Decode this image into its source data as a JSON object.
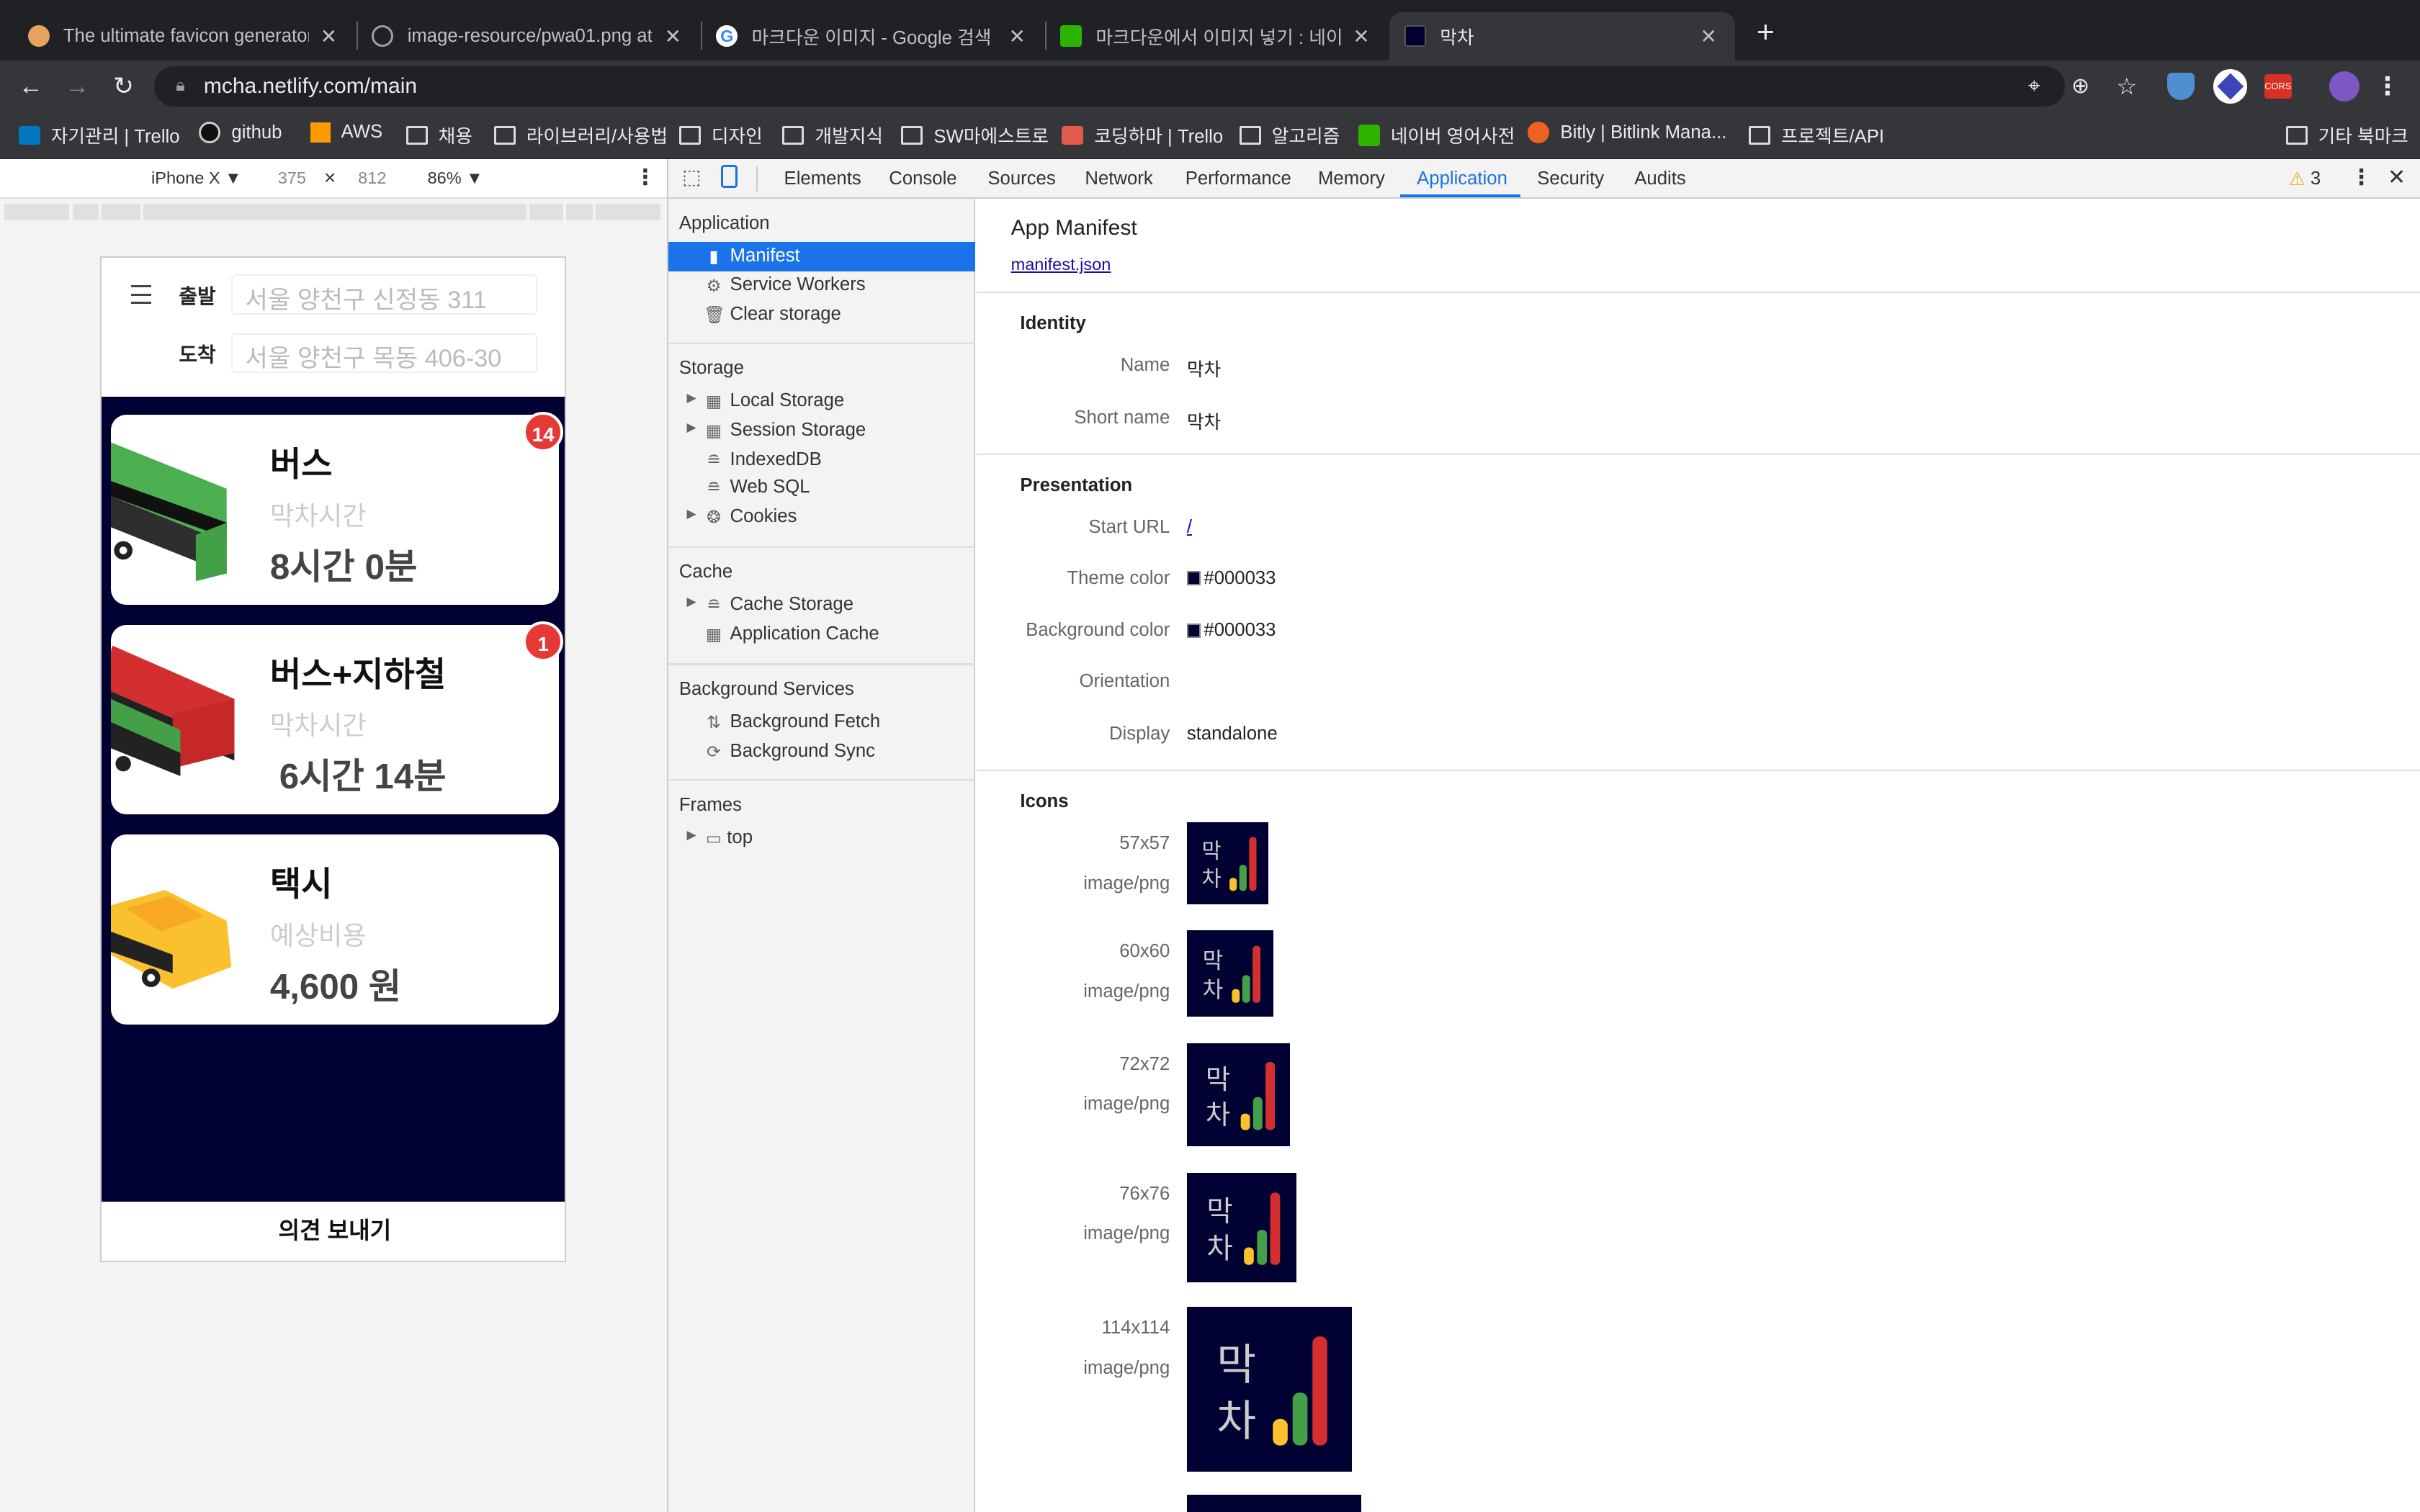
{
  "tabs": [
    {
      "title": "The ultimate favicon generator",
      "fav_color": "#e8a25f"
    },
    {
      "title": "image-resource/pwa01.png at",
      "fav_color": "#202124"
    },
    {
      "title": "마크다운 이미지 - Google 검색",
      "fav_color": "#ffffff"
    },
    {
      "title": "마크다운에서 이미지 넣기 : 네이버",
      "fav_color": "#2db400"
    },
    {
      "title": "막차",
      "fav_color": "#000033"
    }
  ],
  "omnibox": {
    "url": "mcha.netlify.com/main"
  },
  "bookmarks": [
    "자기관리 | Trello",
    "github",
    "AWS",
    "채용",
    "라이브러리/사용법",
    "디자인",
    "개발지식",
    "SW마에스트로",
    "코딩하마 | Trello",
    "알고리즘",
    "네이버 영어사전",
    "Bitly | Bitlink Mana...",
    "프로젝트/API",
    "기타 북마크"
  ],
  "device_toolbar": {
    "device": "iPhone X ▼",
    "width": "375",
    "times": "×",
    "height": "812",
    "zoom": "86% ▼"
  },
  "app": {
    "from_label": "출발",
    "from_value": "서울 양천구 신정동 311",
    "to_label": "도착",
    "to_value": "서울 양천구 목동 406-30",
    "cards": [
      {
        "title": "버스",
        "sub": "막차시간",
        "value": "8시간 0분",
        "badge": "14"
      },
      {
        "title": "버스+지하철",
        "sub": "막차시간",
        "value": "6시간 14분",
        "badge": "1"
      },
      {
        "title": "택시",
        "sub": "예상비용",
        "value": "4,600 원"
      }
    ],
    "footer": "의견 보내기",
    "theme_color": "#000033"
  },
  "devtools": {
    "tabs": [
      "Elements",
      "Console",
      "Sources",
      "Network",
      "Performance",
      "Memory",
      "Application",
      "Security",
      "Audits"
    ],
    "active_tab": "Application",
    "warnings": "3",
    "sidebar": {
      "application": {
        "header": "Application",
        "items": [
          "Manifest",
          "Service Workers",
          "Clear storage"
        ]
      },
      "storage": {
        "header": "Storage",
        "items": [
          "Local Storage",
          "Session Storage",
          "IndexedDB",
          "Web SQL",
          "Cookies"
        ]
      },
      "cache": {
        "header": "Cache",
        "items": [
          "Cache Storage",
          "Application Cache"
        ]
      },
      "background": {
        "header": "Background Services",
        "items": [
          "Background Fetch",
          "Background Sync"
        ]
      },
      "frames": {
        "header": "Frames",
        "items": [
          "top"
        ]
      }
    },
    "manifest": {
      "title": "App Manifest",
      "link": "manifest.json",
      "identity": {
        "header": "Identity",
        "name_label": "Name",
        "name": "막차",
        "short_label": "Short name",
        "short_name": "막차"
      },
      "presentation": {
        "header": "Presentation",
        "start_url_label": "Start URL",
        "start_url": "/",
        "theme_label": "Theme color",
        "theme": "#000033",
        "bg_label": "Background color",
        "bg": "#000033",
        "orientation_label": "Orientation",
        "orientation": "",
        "display_label": "Display",
        "display": "standalone"
      },
      "icons": {
        "header": "Icons",
        "items": [
          {
            "size": "57x57",
            "type": "image/png",
            "icon_text": "막 차"
          },
          {
            "size": "60x60",
            "type": "image/png",
            "icon_text": "막 차"
          },
          {
            "size": "72x72",
            "type": "image/png",
            "icon_text": "막 차"
          },
          {
            "size": "76x76",
            "type": "image/png",
            "icon_text": "막 차"
          },
          {
            "size": "114x114",
            "type": "image/png",
            "icon_text": "막 차"
          }
        ]
      }
    }
  }
}
